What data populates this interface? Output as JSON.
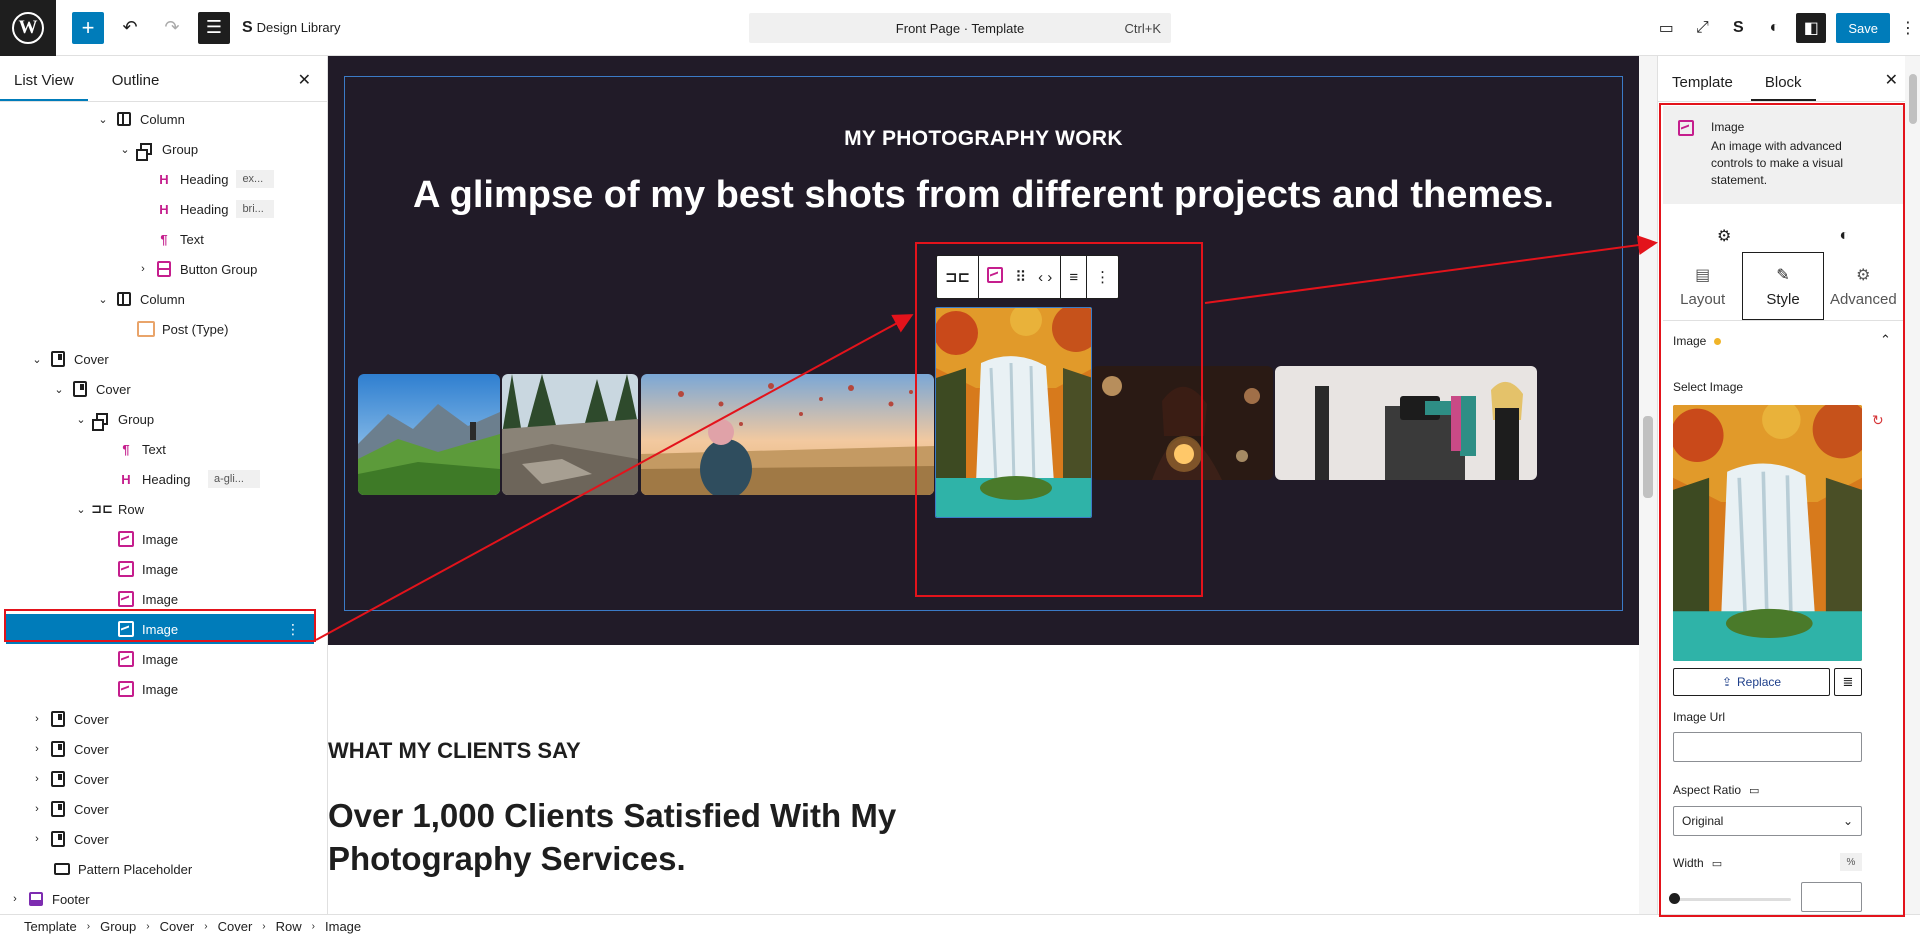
{
  "topbar": {
    "design_library_label": "Design Library",
    "document_title": "Front Page · Template",
    "shortcut": "Ctrl+K",
    "save_label": "Save"
  },
  "list_view": {
    "tabs": [
      "List View",
      "Outline"
    ],
    "items": [
      {
        "label": "Column",
        "icon": "column-icon",
        "tag": ""
      },
      {
        "label": "Group",
        "icon": "group-icon",
        "tag": ""
      },
      {
        "label": "Heading",
        "icon": "heading-icon",
        "tag": "ex..."
      },
      {
        "label": "Heading",
        "icon": "heading-icon",
        "tag": "bri..."
      },
      {
        "label": "Text",
        "icon": "paragraph-icon",
        "tag": ""
      },
      {
        "label": "Button Group",
        "icon": "button-group-icon",
        "tag": ""
      },
      {
        "label": "Column",
        "icon": "column-icon",
        "tag": ""
      },
      {
        "label": "Post (Type)",
        "icon": "post-type-icon",
        "tag": ""
      },
      {
        "label": "Cover",
        "icon": "cover-icon",
        "tag": ""
      },
      {
        "label": "Cover",
        "icon": "cover-icon",
        "tag": ""
      },
      {
        "label": "Group",
        "icon": "group-icon",
        "tag": ""
      },
      {
        "label": "Text",
        "icon": "paragraph-icon",
        "tag": ""
      },
      {
        "label": "Heading",
        "icon": "heading-icon",
        "tag": "a-gli..."
      },
      {
        "label": "Row",
        "icon": "row-icon",
        "tag": ""
      },
      {
        "label": "Image",
        "icon": "image-icon",
        "tag": ""
      },
      {
        "label": "Image",
        "icon": "image-icon",
        "tag": ""
      },
      {
        "label": "Image",
        "icon": "image-icon",
        "tag": ""
      },
      {
        "label": "Image",
        "icon": "image-icon",
        "tag": ""
      },
      {
        "label": "Image",
        "icon": "image-icon",
        "tag": ""
      },
      {
        "label": "Image",
        "icon": "image-icon",
        "tag": ""
      },
      {
        "label": "Cover",
        "icon": "cover-icon",
        "tag": ""
      },
      {
        "label": "Cover",
        "icon": "cover-icon",
        "tag": ""
      },
      {
        "label": "Cover",
        "icon": "cover-icon",
        "tag": ""
      },
      {
        "label": "Cover",
        "icon": "cover-icon",
        "tag": ""
      },
      {
        "label": "Cover",
        "icon": "cover-icon",
        "tag": ""
      },
      {
        "label": "Pattern Placeholder",
        "icon": "pattern-icon",
        "tag": ""
      },
      {
        "label": "Footer",
        "icon": "footer-icon",
        "tag": ""
      }
    ]
  },
  "canvas": {
    "eyebrow": "MY PHOTOGRAPHY WORK",
    "headline": "A glimpse of my best shots from different projects and themes.",
    "section_heading": "WHAT MY CLIENTS SAY",
    "section_title": "Over 1,000 Clients Satisfied With My Photography Services."
  },
  "sidebar": {
    "tabs": [
      "Template",
      "Block"
    ],
    "block_title": "Image",
    "block_description": "An image with advanced controls to make a visual statement.",
    "sub_tabs": [
      "Layout",
      "Style",
      "Advanced"
    ],
    "section_title": "Image",
    "select_image_label": "Select Image",
    "replace_label": "Replace",
    "image_url_label": "Image Url",
    "image_url_value": "",
    "aspect_ratio_label": "Aspect Ratio",
    "aspect_ratio_value": "Original",
    "width_label": "Width",
    "width_unit": "%",
    "width_value": ""
  },
  "breadcrumb": [
    "Template",
    "Group",
    "Cover",
    "Cover",
    "Row",
    "Image"
  ],
  "colors": {
    "accent": "#007cba",
    "cover_bg": "#211b28",
    "annotation_red": "#e3131b",
    "block_icon_pink": "#c51e8d"
  }
}
